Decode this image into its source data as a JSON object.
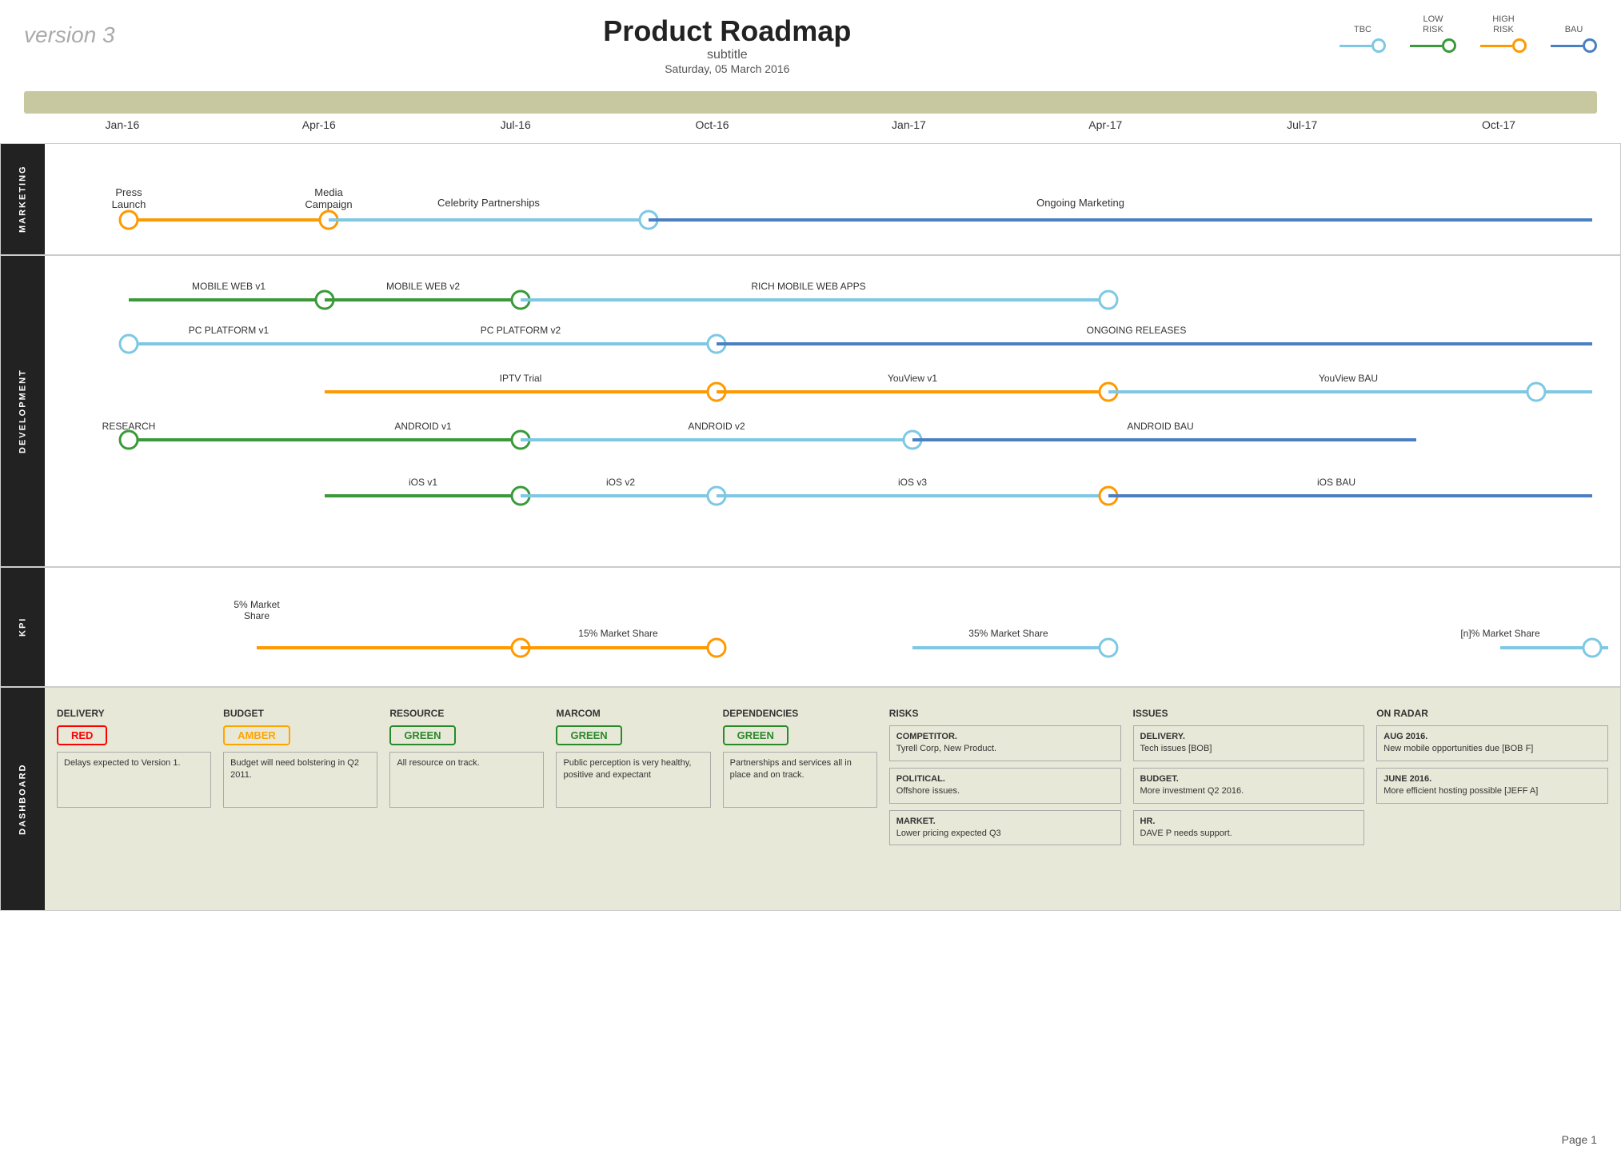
{
  "header": {
    "version": "version 3",
    "title": "Product Roadmap",
    "subtitle": "subtitle",
    "date": "Saturday, 05 March 2016"
  },
  "legend": [
    {
      "id": "tbc",
      "label": "TBC",
      "color": "#7ec8e3",
      "line_color": "#7ec8e3"
    },
    {
      "id": "low_risk",
      "label": "LOW\nRISK",
      "color": "#3a3",
      "line_color": "#3a3"
    },
    {
      "id": "high_risk",
      "label": "HIGH\nRISK",
      "color": "#f90",
      "line_color": "#f90"
    },
    {
      "id": "bau",
      "label": "BAU",
      "color": "#4a7fc1",
      "line_color": "#4a7fc1"
    }
  ],
  "timeline": {
    "months": [
      "Jan-16",
      "Apr-16",
      "Jul-16",
      "Oct-16",
      "Jan-17",
      "Apr-17",
      "Jul-17",
      "Oct-17"
    ]
  },
  "sections": {
    "marketing": {
      "label": "MARKETING",
      "items": [
        {
          "id": "press_launch",
          "label": "Press\nLaunch",
          "label_pos": "above"
        },
        {
          "id": "media_campaign",
          "label": "Media\nCampaign",
          "label_pos": "above"
        },
        {
          "id": "celebrity",
          "label": "Celebrity Partnerships",
          "label_pos": "above"
        },
        {
          "id": "ongoing_marketing",
          "label": "Ongoing Marketing",
          "label_pos": "above"
        }
      ]
    },
    "development": {
      "label": "DEVELOPMENT",
      "items": [
        {
          "id": "mobile_web_v1",
          "label": "MOBILE WEB v1"
        },
        {
          "id": "mobile_web_v2",
          "label": "MOBILE WEB v2"
        },
        {
          "id": "rich_mobile",
          "label": "RICH MOBILE WEB APPS"
        },
        {
          "id": "pc_v1",
          "label": "PC PLATFORM v1"
        },
        {
          "id": "pc_v2",
          "label": "PC PLATFORM v2"
        },
        {
          "id": "ongoing_releases",
          "label": "ONGOING RELEASES"
        },
        {
          "id": "iptv_trial",
          "label": "IPTV Trial"
        },
        {
          "id": "youview_v1",
          "label": "YouView v1"
        },
        {
          "id": "youview_bau",
          "label": "YouView BAU"
        },
        {
          "id": "research",
          "label": "RESEARCH"
        },
        {
          "id": "android_v1",
          "label": "ANDROID v1"
        },
        {
          "id": "android_v2",
          "label": "ANDROID v2"
        },
        {
          "id": "android_bau",
          "label": "ANDROID BAU"
        },
        {
          "id": "ios_v1",
          "label": "iOS v1"
        },
        {
          "id": "ios_v2",
          "label": "iOS v2"
        },
        {
          "id": "ios_v3",
          "label": "iOS v3"
        },
        {
          "id": "ios_bau",
          "label": "iOS BAU"
        }
      ]
    },
    "kpi": {
      "label": "KPI",
      "items": [
        {
          "id": "market_5",
          "label": "5% Market\nShare"
        },
        {
          "id": "market_15",
          "label": "15% Market Share"
        },
        {
          "id": "market_35",
          "label": "35% Market Share"
        },
        {
          "id": "market_n",
          "label": "[n]% Market Share"
        }
      ]
    },
    "dashboard": {
      "label": "DASHBOARD",
      "cards": [
        {
          "id": "delivery",
          "title": "DELIVERY",
          "status": "RED",
          "status_type": "red",
          "text": "Delays expected to Version 1."
        },
        {
          "id": "budget",
          "title": "BUDGET",
          "status": "AMBER",
          "status_type": "amber",
          "text": "Budget will need bolstering in Q2 2011."
        },
        {
          "id": "resource",
          "title": "RESOURCE",
          "status": "GREEN",
          "status_type": "green",
          "text": "All resource on track."
        },
        {
          "id": "marcom",
          "title": "MARCOM",
          "status": "GREEN",
          "status_type": "green",
          "text": "Public perception is very healthy, positive and expectant"
        },
        {
          "id": "dependencies",
          "title": "DEPENDENCIES",
          "status": "GREEN",
          "status_type": "green",
          "text": "Partnerships and services all in place and on track."
        },
        {
          "id": "risks",
          "title": "RISKS",
          "items": [
            {
              "title": "COMPETITOR.",
              "text": "Tyrell Corp, New Product."
            },
            {
              "title": "POLITICAL.",
              "text": "Offshore issues."
            },
            {
              "title": "MARKET.",
              "text": "Lower pricing expected Q3"
            }
          ]
        },
        {
          "id": "issues",
          "title": "ISSUES",
          "items": [
            {
              "title": "DELIVERY.",
              "text": "Tech issues [BOB]"
            },
            {
              "title": "BUDGET.",
              "text": "More investment Q2 2016."
            },
            {
              "title": "HR.",
              "text": "DAVE P needs support."
            }
          ]
        },
        {
          "id": "on_radar",
          "title": "ON RADAR",
          "items": [
            {
              "title": "AUG 2016.",
              "text": "New mobile opportunities due [BOB F]"
            },
            {
              "title": "JUNE 2016.",
              "text": "More efficient hosting possible [JEFF A]"
            }
          ]
        }
      ]
    }
  },
  "page": "Page 1"
}
